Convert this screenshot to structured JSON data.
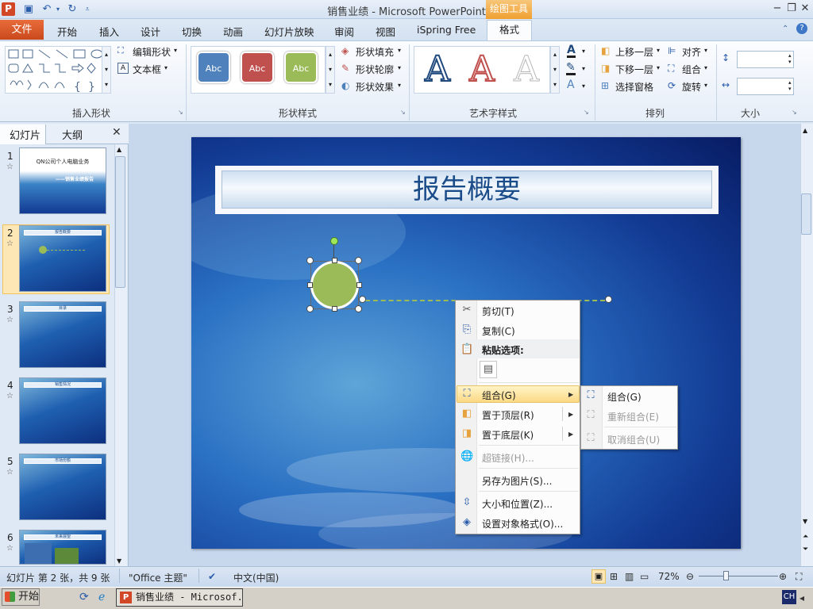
{
  "window": {
    "title": "销售业绩 - Microsoft PowerPoint",
    "contextual_tab_group": "绘图工具"
  },
  "tabs": [
    "文件",
    "开始",
    "插入",
    "设计",
    "切换",
    "动画",
    "幻灯片放映",
    "审阅",
    "视图",
    "iSpring Free",
    "格式"
  ],
  "active_tab": "格式",
  "ribbon": {
    "groups": {
      "insert_shapes": "插入形状",
      "shape_styles": "形状样式",
      "wordart_styles": "艺术字样式",
      "arrange": "排列",
      "size": "大小"
    },
    "edit_shape": "编辑形状",
    "text_box": "文本框",
    "style_samples": [
      "Abc",
      "Abc",
      "Abc"
    ],
    "shape_fill": "形状填充",
    "shape_outline": "形状轮廓",
    "shape_effects": "形状效果",
    "wordart_sample": "A",
    "bring_forward": "上移一层",
    "send_backward": "下移一层",
    "selection_pane": "选择窗格",
    "align": "对齐",
    "group": "组合",
    "rotate": "旋转"
  },
  "left_panel": {
    "tabs": [
      "幻灯片",
      "大纲"
    ],
    "close": "✕",
    "thumbnails": [
      {
        "num": "1",
        "title": "QN公司个人电脑业务",
        "subtitle": "——销售业绩报告"
      },
      {
        "num": "2",
        "title": "报告概要"
      },
      {
        "num": "3",
        "title": "目录"
      },
      {
        "num": "4",
        "title": "销售情况"
      },
      {
        "num": "5",
        "title": "市场份额"
      },
      {
        "num": "6",
        "title": "未来展望"
      }
    ]
  },
  "slide": {
    "title": "报告概要"
  },
  "context_menu": {
    "items": [
      {
        "label": "剪切(T)",
        "enabled": true
      },
      {
        "label": "复制(C)",
        "enabled": true
      },
      {
        "label": "粘贴选项:",
        "enabled": true
      },
      {
        "label": "组合(G)",
        "enabled": true,
        "submenu": true
      },
      {
        "label": "置于顶层(R)",
        "enabled": true,
        "submenu": true
      },
      {
        "label": "置于底层(K)",
        "enabled": true,
        "submenu": true
      },
      {
        "label": "超链接(H)...",
        "enabled": false
      },
      {
        "label": "另存为图片(S)...",
        "enabled": true
      },
      {
        "label": "大小和位置(Z)...",
        "enabled": true
      },
      {
        "label": "设置对象格式(O)...",
        "enabled": true
      }
    ],
    "submenu": [
      {
        "label": "组合(G)",
        "enabled": true
      },
      {
        "label": "重新组合(E)",
        "enabled": false
      },
      {
        "label": "取消组合(U)",
        "enabled": false
      }
    ]
  },
  "status_bar": {
    "slide_info": "幻灯片 第 2 张，共 9 张",
    "theme": "\"Office 主题\"",
    "language": "中文(中国)",
    "zoom": "72%"
  },
  "taskbar": {
    "start": "开始",
    "task": "销售业绩 - Microsof...",
    "ime": "CH"
  },
  "colors": {
    "file_tab": "#d24726",
    "accent_green": "#9bbb59",
    "slide_title": "#1b4c8a",
    "style_blue": "#4f81bd",
    "style_red": "#c0504d",
    "style_green": "#9bbb59"
  }
}
